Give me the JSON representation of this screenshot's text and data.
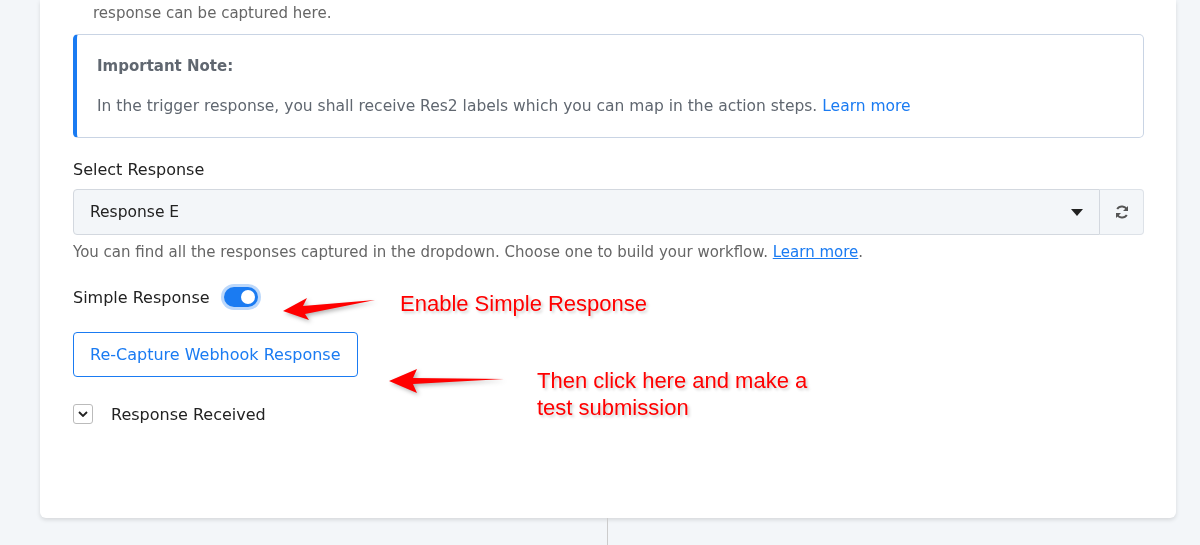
{
  "intro_text": "response can be captured here.",
  "note": {
    "title": "Important Note:",
    "text": "In the trigger response, you shall receive Res2 labels which you can map in the action steps.",
    "link": "Learn more"
  },
  "select": {
    "label": "Select Response",
    "value": "Response E",
    "hint": "You can find all the responses captured in the dropdown. Choose one to build your workflow.",
    "hint_link": "Learn more",
    "hint_end": "."
  },
  "toggle": {
    "label": "Simple Response",
    "on": true
  },
  "button": {
    "label": "Re-Capture Webhook Response"
  },
  "collapsible": {
    "label": "Response Received",
    "expanded": false
  },
  "annotations": [
    {
      "text": "Enable Simple Response"
    },
    {
      "text": "Then click here and make a test submission"
    }
  ]
}
